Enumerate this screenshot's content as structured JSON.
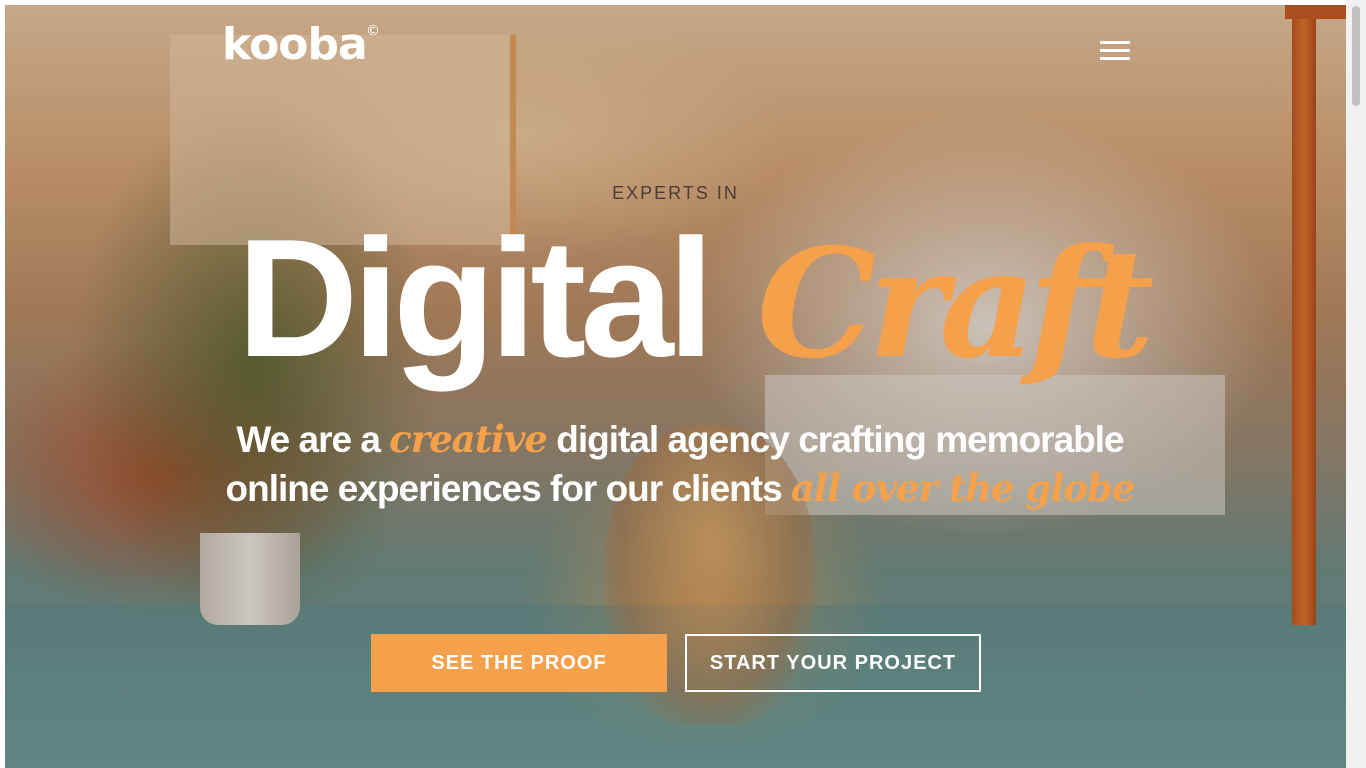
{
  "header": {
    "logo_text": "kooba",
    "logo_mark": "©",
    "menu_icon": "hamburger-menu-icon"
  },
  "hero": {
    "kicker": "EXPERTS IN",
    "headline_main": "Digital",
    "headline_accent": "Craft",
    "tagline": {
      "part1": "We are a ",
      "em1": "creative",
      "part2": " digital agency crafting memorable online experiences for our clients ",
      "em2": "all over the globe"
    }
  },
  "actions": {
    "primary_label": "SEE THE PROOF",
    "secondary_label": "START YOUR PROJECT"
  },
  "colors": {
    "accent": "#f5a04a",
    "text": "#ffffff"
  }
}
